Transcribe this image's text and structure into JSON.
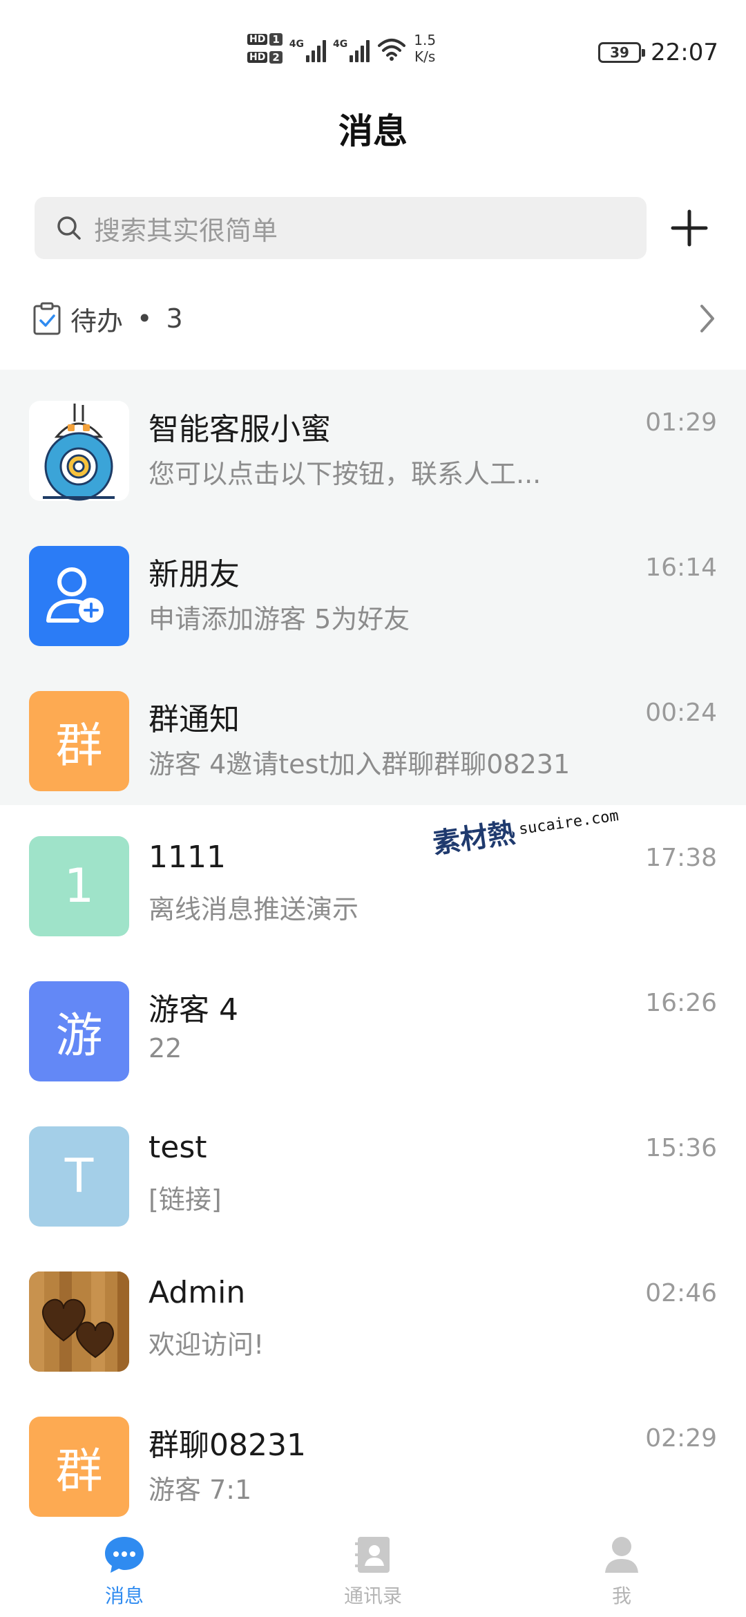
{
  "status_bar": {
    "sim1": "HD",
    "sim1_num": "1",
    "sim2": "HD",
    "sim2_num": "2",
    "net1": "4G",
    "net2": "4G",
    "speed_value": "1.5",
    "speed_unit": "K/s",
    "battery": "39",
    "time": "22:07"
  },
  "header": {
    "title": "消息"
  },
  "search": {
    "placeholder": "搜索其实很简单",
    "icon": "search-icon",
    "add_icon": "plus-icon"
  },
  "todo": {
    "label": "待办",
    "separator": "•",
    "count": "3"
  },
  "conversations": [
    {
      "name": "智能客服小蜜",
      "preview": "您可以点击以下按钮，联系人工...",
      "time": "01:29",
      "pinned": true,
      "avatar_type": "robot"
    },
    {
      "name": "新朋友",
      "preview": "申请添加游客 5为好友",
      "time": "16:14",
      "pinned": true,
      "avatar_type": "add-user",
      "avatar_color": "#2b7cf6"
    },
    {
      "name": "群通知",
      "preview": "游客 4邀请test加入群聊群聊08231",
      "time": "00:24",
      "pinned": true,
      "avatar_text": "群",
      "avatar_color": "#fdaa52"
    },
    {
      "name": "1111",
      "preview": "离线消息推送演示",
      "time": "17:38",
      "pinned": false,
      "avatar_text": "1",
      "avatar_color": "#9fe3c9"
    },
    {
      "name": "游客 4",
      "preview": "22",
      "time": "16:26",
      "pinned": false,
      "avatar_text": "游",
      "avatar_color": "#6388f6"
    },
    {
      "name": "test",
      "preview": "[链接]",
      "time": "15:36",
      "pinned": false,
      "avatar_text": "T",
      "avatar_color": "#a4cfe8"
    },
    {
      "name": "Admin",
      "preview": "欢迎访问!",
      "time": "02:46",
      "pinned": false,
      "avatar_type": "hearts-wood"
    },
    {
      "name": "群聊08231",
      "preview": "游客 7:1",
      "time": "02:29",
      "pinned": false,
      "avatar_text": "群",
      "avatar_color": "#fdaa52"
    }
  ],
  "watermark": {
    "zh": "素材熱",
    "en": "sucaire.com"
  },
  "tabs": [
    {
      "label": "消息",
      "icon": "chat-bubble-icon",
      "active": true
    },
    {
      "label": "通讯录",
      "icon": "contacts-book-icon",
      "active": false
    },
    {
      "label": "我",
      "icon": "user-profile-icon",
      "active": false
    }
  ],
  "colors": {
    "accent": "#2f8bf0",
    "inactive_tab": "#b5b5b5",
    "pinned_bg": "#f4f6f6"
  }
}
